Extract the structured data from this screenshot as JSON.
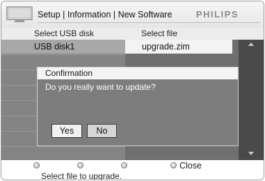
{
  "header": {
    "breadcrumb": "Setup | Information | New Software",
    "brand": "PHILIPS",
    "icon": "tv-icon"
  },
  "columns": {
    "left_heading": "Select USB disk",
    "right_heading": "Select file"
  },
  "left_list": {
    "items": [
      {
        "label": "USB disk1",
        "selected": true
      }
    ]
  },
  "right_list": {
    "items": [
      {
        "label": "upgrade.zim",
        "selected": true
      }
    ]
  },
  "scrollbar": {
    "up_icon": "arrow-up-icon",
    "down_icon": "arrow-down-icon"
  },
  "dialog": {
    "title": "Confirmation",
    "message": "Do you really want to update?",
    "yes_label": "Yes",
    "no_label": "No"
  },
  "footer": {
    "buttons": [
      {
        "icon": "option-dot-icon",
        "label": ""
      },
      {
        "icon": "option-dot-icon",
        "label": ""
      },
      {
        "icon": "option-dot-icon",
        "label": ""
      },
      {
        "icon": "option-dot-icon",
        "label": "Close"
      }
    ],
    "hint": "Select file to upgrade."
  },
  "colors": {
    "header_bg": "#eeeeee",
    "list_bg": "#848484",
    "pane_dark": "#6f6f6f",
    "scrollbar": "#4a4a4a",
    "selected_row": "#f3f3f3",
    "brand_text": "#8a8a8a"
  }
}
